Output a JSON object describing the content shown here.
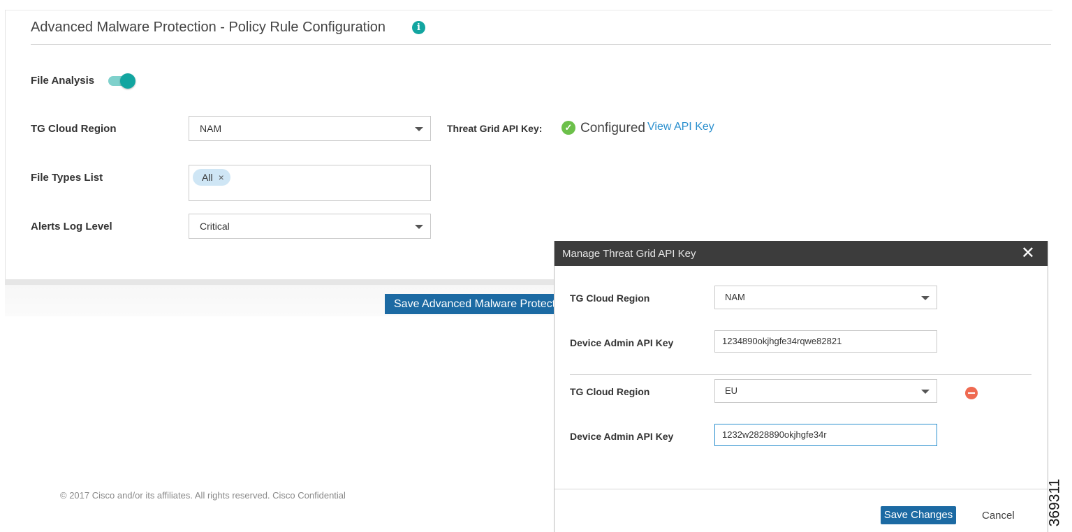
{
  "page": {
    "title": "Advanced Malware Protection - Policy Rule Configuration",
    "info_icon_glyph": "i",
    "file_analysis": {
      "label": "File Analysis",
      "enabled": true
    },
    "tg_cloud_region": {
      "label": "TG Cloud Region",
      "value": "NAM"
    },
    "threat_grid": {
      "label": "Threat Grid API Key:",
      "status": "Configured",
      "link": "View API Key",
      "status_icon": "check-circle-icon"
    },
    "file_types": {
      "label": "File Types List",
      "tags": [
        {
          "label": "All",
          "remove_glyph": "×"
        }
      ]
    },
    "alerts_log_level": {
      "label": "Alerts Log Level",
      "value": "Critical"
    },
    "save_button": "Save Advanced Malware Protection",
    "copyright": "© 2017  Cisco and/or its affiliates. All rights reserved.   Cisco Confidential"
  },
  "modal": {
    "title": "Manage Threat Grid API Key",
    "close_glyph": "✕",
    "entries": [
      {
        "region_label": "TG Cloud Region",
        "region_value": "NAM",
        "key_label": "Device Admin API Key",
        "key_value": "1234890okjhgfe34rqwe82821"
      },
      {
        "region_label": "TG Cloud Region",
        "region_value": "EU",
        "key_label": "Device Admin API Key",
        "key_value": "1232w2828890okjhgfe34r"
      }
    ],
    "save_label": "Save Changes",
    "cancel_label": "Cancel"
  },
  "figure_id": "369311",
  "colors": {
    "accent_teal": "#12a5a0",
    "primary_blue": "#1c6aa3",
    "link_blue": "#2a8fce",
    "remove_red": "#ef6a51",
    "ok_green": "#6cc04a"
  }
}
